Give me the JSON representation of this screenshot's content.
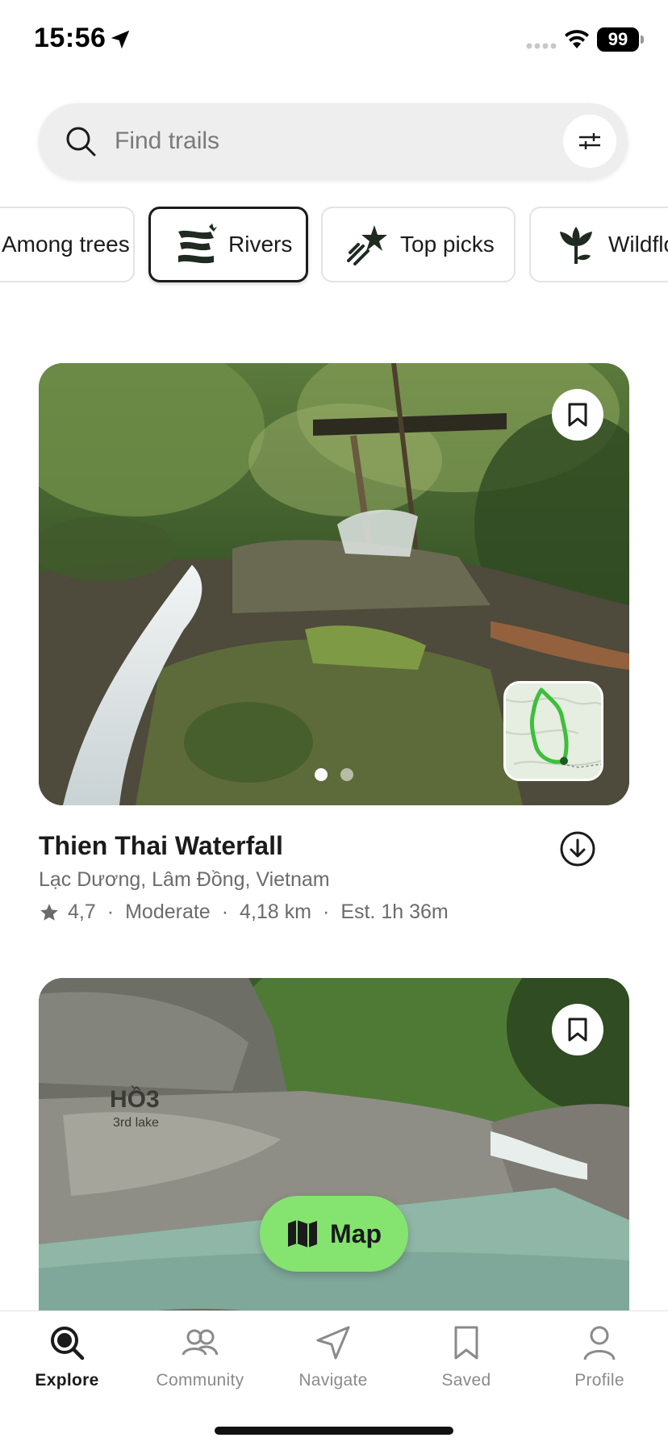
{
  "status_bar": {
    "time": "15:56",
    "battery": "99"
  },
  "search": {
    "placeholder": "Find trails"
  },
  "categories": [
    {
      "label": "Among trees",
      "icon": "tree-icon",
      "active": false
    },
    {
      "label": "Rivers",
      "icon": "river-icon",
      "active": true
    },
    {
      "label": "Top picks",
      "icon": "stars-icon",
      "active": false
    },
    {
      "label": "Wildflowers",
      "icon": "flower-icon",
      "active": false
    }
  ],
  "trails": [
    {
      "name": "Thien Thai Waterfall",
      "location": "Lạc Dương, Lâm Đồng, Vietnam",
      "rating": "4,7",
      "difficulty": "Moderate",
      "distance": "4,18 km",
      "duration": "Est. 1h 36m",
      "photo_count": 2,
      "active_photo": 1
    },
    {
      "name": "",
      "location": "",
      "photo_sign_text": "HỒ3 3rd lake"
    }
  ],
  "map_button": {
    "label": "Map"
  },
  "tabs": [
    {
      "label": "Explore",
      "icon": "explore-icon",
      "active": true
    },
    {
      "label": "Community",
      "icon": "community-icon",
      "active": false
    },
    {
      "label": "Navigate",
      "icon": "navigate-icon",
      "active": false
    },
    {
      "label": "Saved",
      "icon": "bookmark-icon",
      "active": false
    },
    {
      "label": "Profile",
      "icon": "profile-icon",
      "active": false
    }
  ],
  "colors": {
    "accent_green": "#84e46f",
    "route_green": "#3dbf3a",
    "text_primary": "#1b1b1b",
    "text_secondary": "#6b6b6b"
  }
}
